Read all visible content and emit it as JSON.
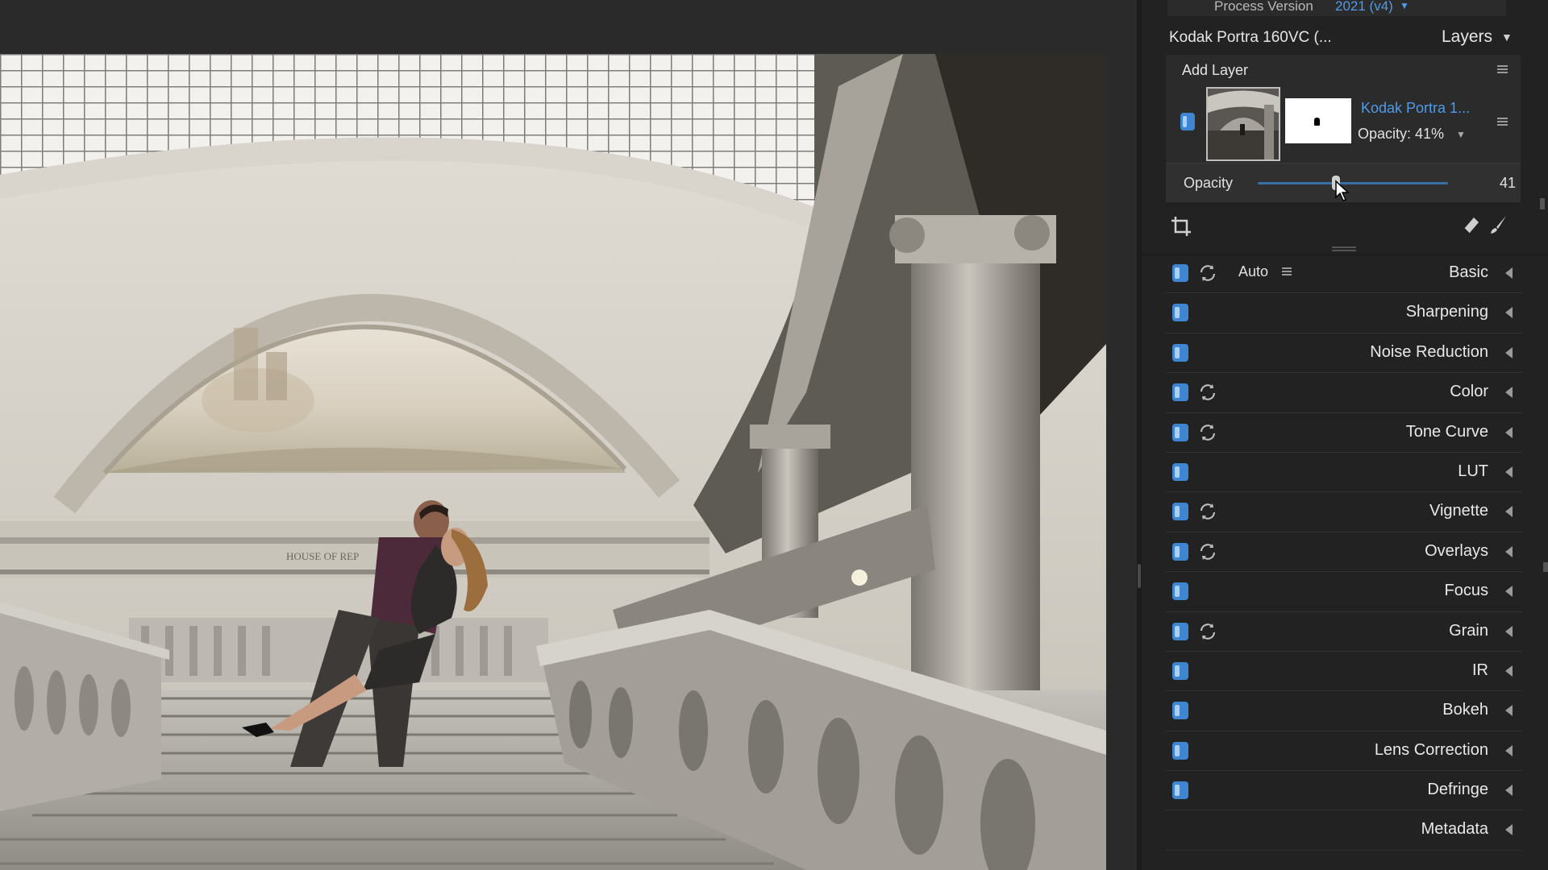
{
  "process": {
    "label": "Process Version",
    "value": "2021 (v4)"
  },
  "preset": {
    "name": "Kodak Portra 160VC (...",
    "layers_label": "Layers"
  },
  "layers": {
    "add_layer_label": "Add Layer",
    "items": [
      {
        "name": "Kodak Portra 1...",
        "opacity_text": "Opacity: 41%"
      }
    ]
  },
  "opacity": {
    "label": "Opacity",
    "value": "41",
    "level": 0.41
  },
  "modules": [
    {
      "label": "Basic",
      "toggle": true,
      "reset": true,
      "auto": "Auto"
    },
    {
      "label": "Sharpening",
      "toggle": true,
      "reset": false
    },
    {
      "label": "Noise Reduction",
      "toggle": true,
      "reset": false
    },
    {
      "label": "Color",
      "toggle": true,
      "reset": true
    },
    {
      "label": "Tone Curve",
      "toggle": true,
      "reset": true
    },
    {
      "label": "LUT",
      "toggle": true,
      "reset": false
    },
    {
      "label": "Vignette",
      "toggle": true,
      "reset": true
    },
    {
      "label": "Overlays",
      "toggle": true,
      "reset": true
    },
    {
      "label": "Focus",
      "toggle": true,
      "reset": false
    },
    {
      "label": "Grain",
      "toggle": true,
      "reset": true
    },
    {
      "label": "IR",
      "toggle": true,
      "reset": false
    },
    {
      "label": "Bokeh",
      "toggle": true,
      "reset": false
    },
    {
      "label": "Lens Correction",
      "toggle": true,
      "reset": false
    },
    {
      "label": "Defringe",
      "toggle": true,
      "reset": false
    },
    {
      "label": "Metadata",
      "toggle": false,
      "reset": false
    }
  ],
  "colors": {
    "accent": "#4f9be8",
    "toggle": "#3e86d1",
    "panel": "#222222"
  },
  "icons": [
    "crop-icon",
    "eraser-icon",
    "brush-icon",
    "reset-icon",
    "menu-icon",
    "chevron-left-icon",
    "cursor-icon"
  ]
}
